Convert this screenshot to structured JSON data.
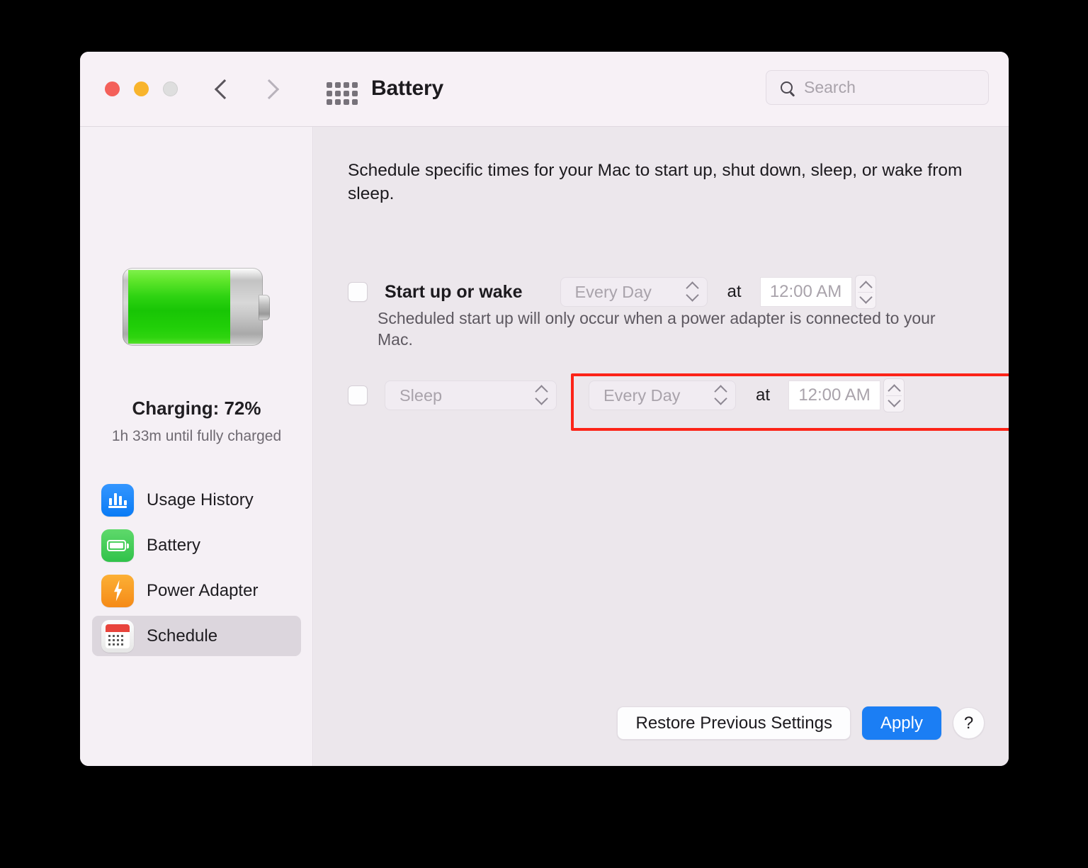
{
  "window": {
    "title": "Battery",
    "traffic_lights": [
      "close",
      "minimize",
      "zoom"
    ],
    "back_icon": "chevron-left-icon",
    "forward_icon": "chevron-right-icon",
    "grid_icon": "show-all-grid-icon"
  },
  "search": {
    "placeholder": "Search",
    "value": "",
    "icon": "search-icon"
  },
  "sidebar": {
    "battery": {
      "icon": "battery-charging-icon",
      "fill_percent": 72,
      "status": "Charging: 72%",
      "subtitle": "1h 33m until fully charged"
    },
    "items": [
      {
        "label": "Usage History",
        "icon": "usage-history-icon",
        "selected": false
      },
      {
        "label": "Battery",
        "icon": "battery-icon",
        "selected": false
      },
      {
        "label": "Power Adapter",
        "icon": "power-adapter-icon",
        "selected": false
      },
      {
        "label": "Schedule",
        "icon": "schedule-calendar-icon",
        "selected": true
      }
    ]
  },
  "main": {
    "intro": "Schedule specific times for your Mac to start up, shut down, sleep, or wake from sleep.",
    "startup_row": {
      "checkbox_checked": false,
      "label": "Start up or wake",
      "day_value": "Every Day",
      "at_label": "at",
      "time_value": "12:00 AM",
      "helper": "Scheduled start up will only occur when a power adapter is connected to your Mac."
    },
    "sleep_row": {
      "checkbox_checked": false,
      "action_value": "Sleep",
      "day_value": "Every Day",
      "at_label": "at",
      "time_value": "12:00 AM",
      "highlighted": true,
      "highlight_color": "#fc2418"
    }
  },
  "footer": {
    "restore_label": "Restore Previous Settings",
    "apply_label": "Apply",
    "help_label": "?",
    "apply_color": "#1b7ef4"
  }
}
